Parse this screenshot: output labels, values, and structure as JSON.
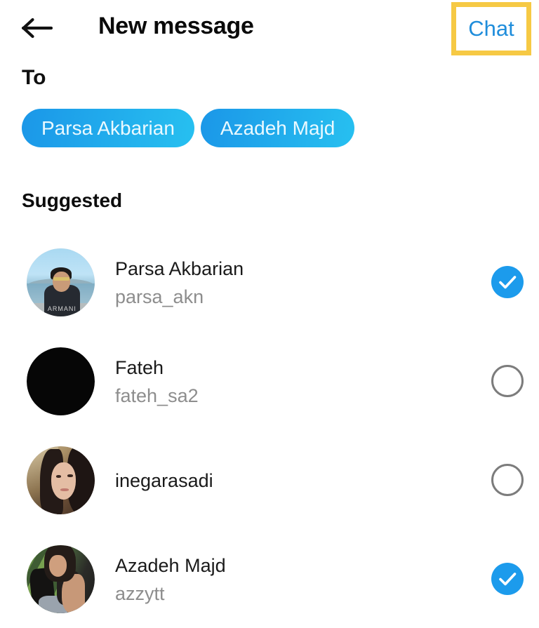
{
  "header": {
    "back_icon": "back-arrow-icon",
    "title": "New message",
    "action_label": "Chat",
    "action_highlight_color": "#f6c944",
    "action_text_color": "#1f8ddb"
  },
  "compose": {
    "to_label": "To",
    "recipients": [
      {
        "name": "Parsa Akbarian"
      },
      {
        "name": "Azadeh Majd"
      }
    ],
    "chip_gradient_from": "#1b97e8",
    "chip_gradient_to": "#27c0f0"
  },
  "suggested": {
    "section_title": "Suggested",
    "selected_color": "#1c9bec",
    "unselected_color": "#7c7c7c",
    "people": [
      {
        "name": "Parsa Akbarian",
        "username": "parsa_akn",
        "selected": true,
        "avatar": "av-parsa",
        "check_icon": "check-filled-icon"
      },
      {
        "name": "Fateh",
        "username": "fateh_sa2",
        "selected": false,
        "avatar": "av-fateh",
        "check_icon": "circle-outline-icon"
      },
      {
        "name": "inegarasadi",
        "username": "",
        "selected": false,
        "avatar": "av-inegar",
        "check_icon": "circle-outline-icon"
      },
      {
        "name": "Azadeh Majd",
        "username": "azzytt",
        "selected": true,
        "avatar": "av-azadeh",
        "check_icon": "check-filled-icon"
      }
    ]
  }
}
